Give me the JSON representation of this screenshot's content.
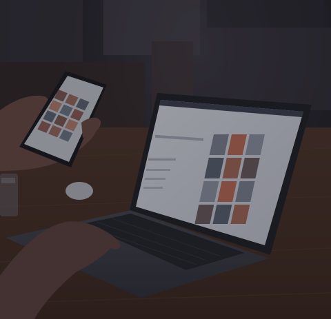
{
  "scene": {
    "palette": {
      "background": "#26232b",
      "table": "#4a3227",
      "laptop_body": "#3a3b44",
      "screen": "#d9dce6",
      "phone_screen": "#c9ccd6",
      "skin": "#6b4a44"
    },
    "phone_thumbnails": [
      "#7d5a52",
      "#9a6c5c",
      "#5d6676",
      "#b7826e",
      "#6f7888",
      "#8e5f58"
    ],
    "laptop_thumbnails": [
      "#7e8596",
      "#c06c57",
      "#5b6374",
      "#a56a5a",
      "#8f97a6",
      "#6c5b5f"
    ]
  }
}
